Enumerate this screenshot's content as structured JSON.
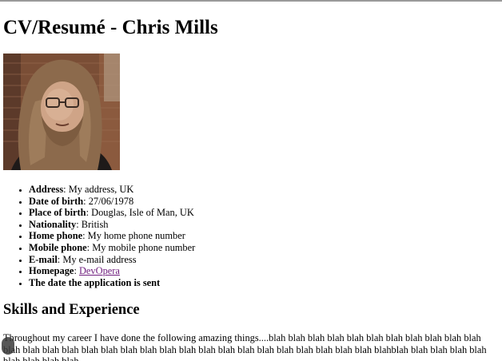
{
  "page": {
    "title": "CV/Resumé - Chris Mills"
  },
  "photo": {
    "alt": "Photo of Chris Mills"
  },
  "details": [
    {
      "label": "Address",
      "sep": ": ",
      "value": "My address, UK"
    },
    {
      "label": "Date of birth",
      "sep": ": ",
      "value": "27/06/1978"
    },
    {
      "label": "Place of birth",
      "sep": ": ",
      "value": "Douglas, Isle of Man, UK"
    },
    {
      "label": "Nationality",
      "sep": ": ",
      "value": "British"
    },
    {
      "label": "Home phone",
      "sep": ": ",
      "value": "My home phone number"
    },
    {
      "label": "Mobile phone",
      "sep": ": ",
      "value": "My mobile phone number"
    },
    {
      "label": "E-mail",
      "sep": ": ",
      "value": "My e-mail address"
    },
    {
      "label": "Homepage",
      "sep": ": ",
      "link": "DevOpera"
    },
    {
      "label": "The date the application is sent"
    }
  ],
  "skills": {
    "heading": "Skills and Experience",
    "text": "Throughout my career I have done the following amazing things....blah blah blah blah blah blah blah blah blah blah blah blah blah blah blah blah blah blah blah blah blah blah blah blah blah blah blah blah blah blah blahblah blah blah blah blah blah blah blah blah"
  },
  "colors": {
    "link": "#6f1e7e",
    "top_border": "#9a9a9a"
  }
}
